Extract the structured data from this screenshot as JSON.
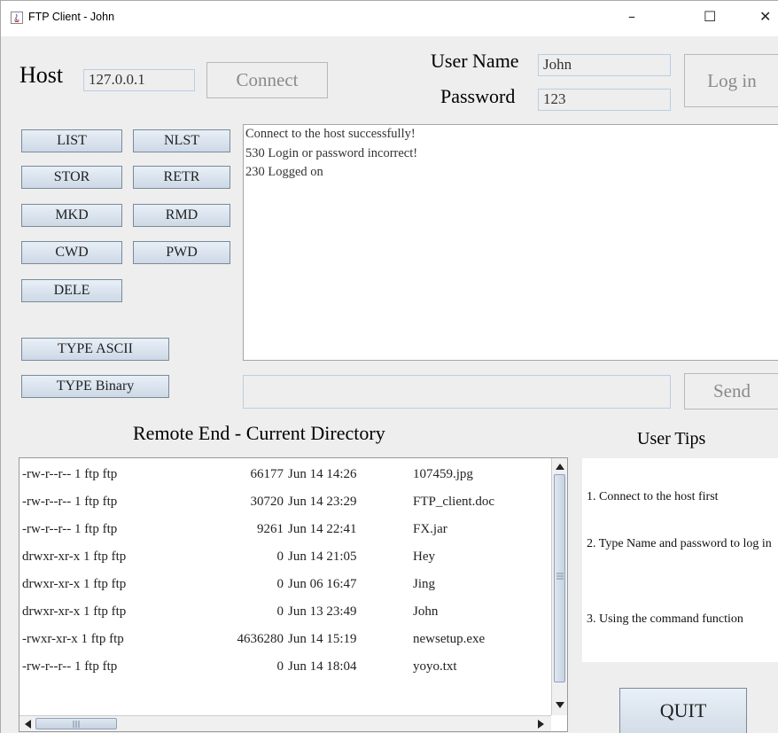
{
  "window": {
    "title": "FTP Client - John"
  },
  "connection": {
    "host_label": "Host",
    "host_value": "127.0.0.1",
    "connect_label": "Connect",
    "username_label": "User Name",
    "username_value": "John",
    "password_label": "Password",
    "password_value": "123",
    "login_label": "Log in"
  },
  "commands": [
    "LIST",
    "NLST",
    "STOR",
    "RETR",
    "MKD",
    "RMD",
    "CWD",
    "PWD",
    "DELE",
    "TYPE ASCII",
    "TYPE Binary"
  ],
  "messages": [
    "Connect to the host successfully!",
    "530 Login or password incorrect!",
    "230 Logged on"
  ],
  "command_input": {
    "value": "",
    "send_label": "Send"
  },
  "remote": {
    "title": "Remote End - Current Directory",
    "files": [
      {
        "perm": "-rw-r--r-- 1 ftp ftp",
        "size": "66177",
        "date": "Jun 14 14:26",
        "name": "107459.jpg"
      },
      {
        "perm": "-rw-r--r-- 1 ftp ftp",
        "size": "30720",
        "date": "Jun 14 23:29",
        "name": "FTP_client.doc"
      },
      {
        "perm": "-rw-r--r-- 1 ftp ftp",
        "size": "9261",
        "date": "Jun 14 22:41",
        "name": "FX.jar"
      },
      {
        "perm": "drwxr-xr-x 1 ftp ftp",
        "size": "0",
        "date": "Jun 14 21:05",
        "name": "Hey"
      },
      {
        "perm": "drwxr-xr-x 1 ftp ftp",
        "size": "0",
        "date": "Jun 06 16:47",
        "name": "Jing"
      },
      {
        "perm": "drwxr-xr-x 1 ftp ftp",
        "size": "0",
        "date": "Jun 13 23:49",
        "name": "John"
      },
      {
        "perm": "-rwxr-xr-x 1 ftp ftp",
        "size": "4636280",
        "date": "Jun 14 15:19",
        "name": "newsetup.exe"
      },
      {
        "perm": "-rw-r--r-- 1 ftp ftp",
        "size": "0",
        "date": "Jun 14 18:04",
        "name": "yoyo.txt"
      }
    ]
  },
  "tips": {
    "title": "User Tips",
    "items": [
      "1. Connect to the host first",
      "2. Type Name and password to log in",
      "3. Using the command function"
    ]
  },
  "quit_label": "QUIT",
  "window_controls": {
    "minimize": "–",
    "maximize": "☐",
    "close": "✕"
  }
}
